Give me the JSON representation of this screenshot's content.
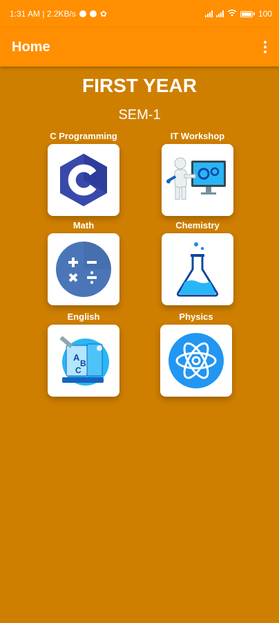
{
  "status": {
    "time_speed": "1:31 AM | 2.2KB/s",
    "battery": "100"
  },
  "app_bar": {
    "title": "Home"
  },
  "page": {
    "title": "FIRST YEAR",
    "semester": "SEM-1"
  },
  "subjects": [
    {
      "label": "C Programming",
      "icon": "c-language-icon"
    },
    {
      "label": "IT Workshop",
      "icon": "it-workshop-icon"
    },
    {
      "label": "Math",
      "icon": "math-operators-icon"
    },
    {
      "label": "Chemistry",
      "icon": "flask-icon"
    },
    {
      "label": "English",
      "icon": "english-books-icon"
    },
    {
      "label": "Physics",
      "icon": "atom-icon"
    }
  ],
  "colors": {
    "background": "#CF7F00",
    "app_bar": "#FF8F00"
  }
}
